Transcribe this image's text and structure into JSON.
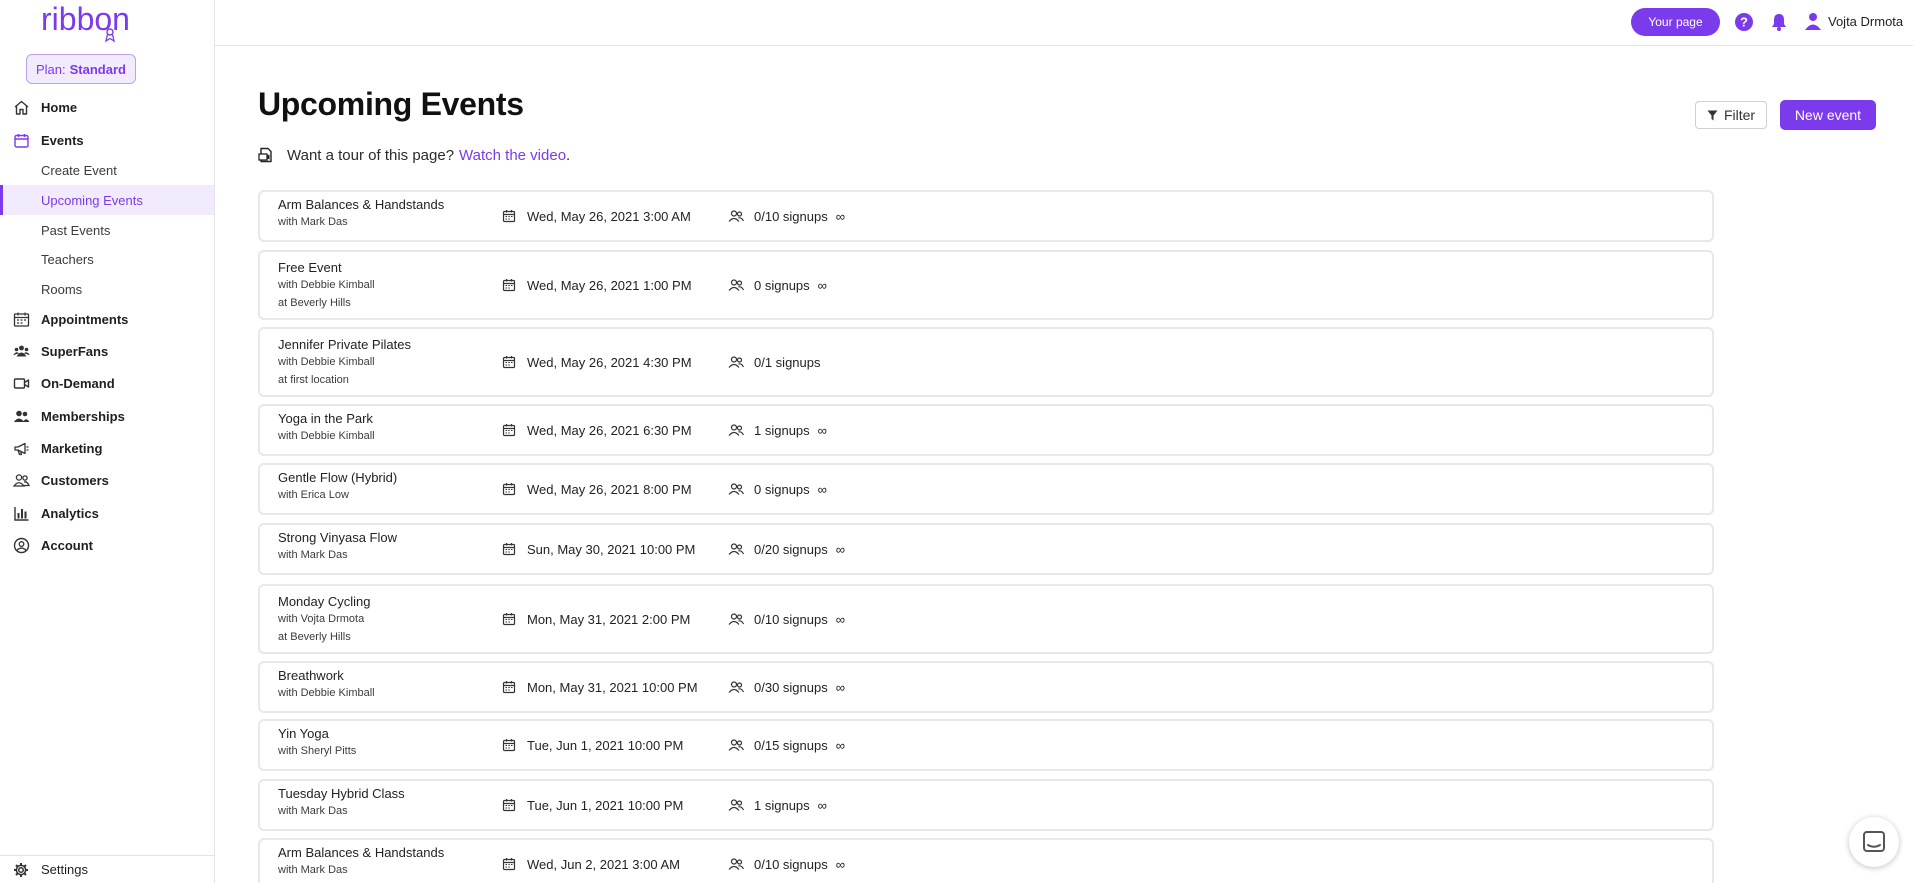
{
  "sidebar": {
    "logo": "ribbon",
    "plan_prefix": "Plan:",
    "plan_name": "Standard",
    "items": [
      {
        "label": "Home",
        "icon": "home-icon"
      },
      {
        "label": "Events",
        "icon": "calendar-icon"
      },
      {
        "label": "Appointments",
        "icon": "appointments-icon"
      },
      {
        "label": "SuperFans",
        "icon": "superfans-icon"
      },
      {
        "label": "On-Demand",
        "icon": "video-icon"
      },
      {
        "label": "Memberships",
        "icon": "memberships-icon"
      },
      {
        "label": "Marketing",
        "icon": "megaphone-icon"
      },
      {
        "label": "Customers",
        "icon": "customers-icon"
      },
      {
        "label": "Analytics",
        "icon": "analytics-icon"
      },
      {
        "label": "Account",
        "icon": "account-icon"
      }
    ],
    "sub_items": [
      "Create Event",
      "Upcoming Events",
      "Past Events",
      "Teachers",
      "Rooms"
    ],
    "active_sub_item": "Upcoming Events",
    "settings_label": "Settings"
  },
  "topbar": {
    "your_page_label": "Your page",
    "user_name": "Vojta Drmota"
  },
  "main": {
    "title": "Upcoming Events",
    "filter_label": "Filter",
    "new_event_label": "New event",
    "tour_text": "Want a tour of this page?",
    "tour_link": "Watch the video",
    "tour_period": "."
  },
  "events": [
    {
      "name": "Arm Balances & Handstands",
      "teacher": "with Mark Das",
      "location": "",
      "date": "Wed, May 26, 2021 3:00 AM",
      "signups": "0/10 signups",
      "infinite": true
    },
    {
      "name": "Free Event",
      "teacher": "with Debbie Kimball",
      "location": "at Beverly Hills",
      "date": "Wed, May 26, 2021 1:00 PM",
      "signups": "0 signups",
      "infinite": true
    },
    {
      "name": "Jennifer Private Pilates",
      "teacher": "with Debbie Kimball",
      "location": "at first location",
      "date": "Wed, May 26, 2021 4:30 PM",
      "signups": "0/1 signups",
      "infinite": false
    },
    {
      "name": "Yoga in the Park",
      "teacher": "with Debbie Kimball",
      "location": "",
      "date": "Wed, May 26, 2021 6:30 PM",
      "signups": "1 signups",
      "infinite": true
    },
    {
      "name": "Gentle Flow (Hybrid)",
      "teacher": "with Erica Low",
      "location": "",
      "date": "Wed, May 26, 2021 8:00 PM",
      "signups": "0 signups",
      "infinite": true
    },
    {
      "name": "Strong Vinyasa Flow",
      "teacher": "with Mark Das",
      "location": "",
      "date": "Sun, May 30, 2021 10:00 PM",
      "signups": "0/20 signups",
      "infinite": true
    },
    {
      "name": "Monday Cycling",
      "teacher": "with Vojta Drmota",
      "location": "at Beverly Hills",
      "date": "Mon, May 31, 2021 2:00 PM",
      "signups": "0/10 signups",
      "infinite": true
    },
    {
      "name": "Breathwork",
      "teacher": "with Debbie Kimball",
      "location": "",
      "date": "Mon, May 31, 2021 10:00 PM",
      "signups": "0/30 signups",
      "infinite": true
    },
    {
      "name": "Yin Yoga",
      "teacher": "with Sheryl Pitts",
      "location": "",
      "date": "Tue, Jun 1, 2021 10:00 PM",
      "signups": "0/15 signups",
      "infinite": true
    },
    {
      "name": "Tuesday Hybrid Class",
      "teacher": "with Mark Das",
      "location": "",
      "date": "Tue, Jun 1, 2021 10:00 PM",
      "signups": "1 signups",
      "infinite": true
    },
    {
      "name": "Arm Balances & Handstands",
      "teacher": "with Mark Das",
      "location": "",
      "date": "Wed, Jun 2, 2021 3:00 AM",
      "signups": "0/10 signups",
      "infinite": true
    }
  ],
  "colors": {
    "accent": "#7c3aed",
    "accent_light": "#f1ebfd"
  },
  "infinity_symbol": "∞"
}
